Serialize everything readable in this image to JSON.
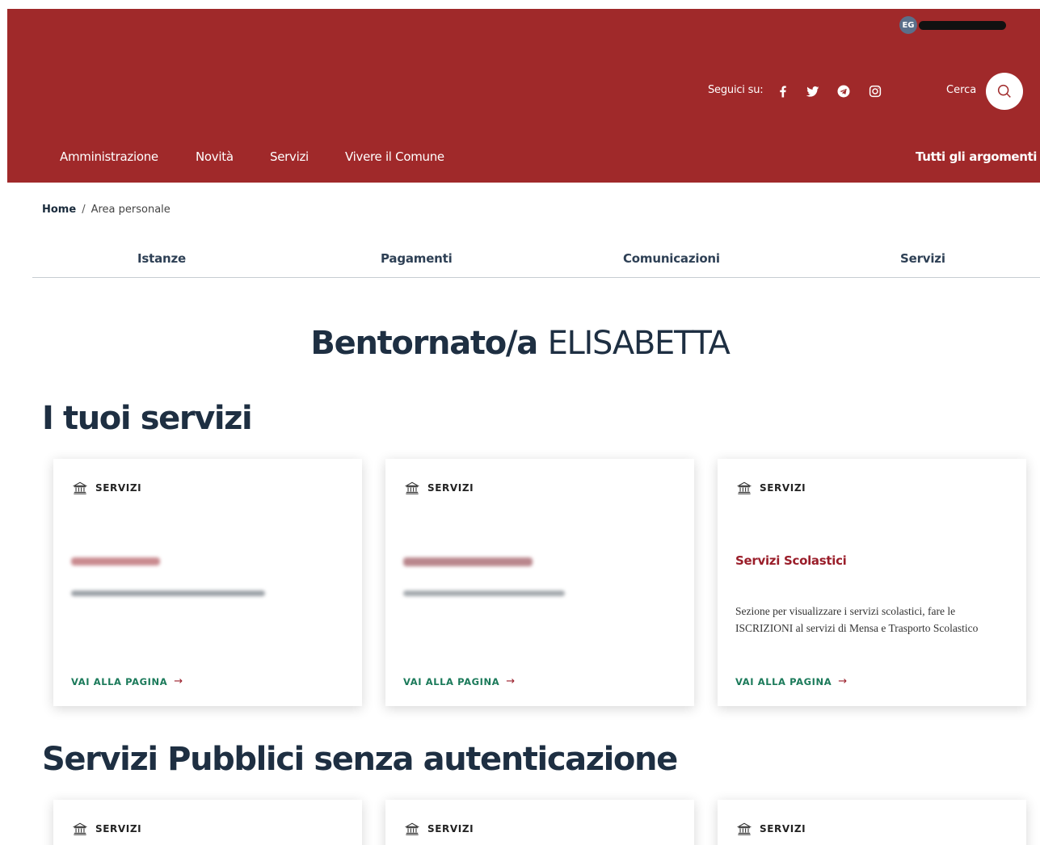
{
  "header": {
    "user_initials": "EG",
    "social_label": "Seguici su:",
    "social_icons": [
      "facebook-icon",
      "twitter-icon",
      "telegram-icon",
      "instagram-icon"
    ],
    "search_label": "Cerca",
    "nav": [
      "Amministrazione",
      "Novità",
      "Servizi",
      "Vivere il Comune"
    ],
    "nav_all_topics": "Tutti gli argomenti"
  },
  "breadcrumb": {
    "home": "Home",
    "separator": "/",
    "current": "Area personale"
  },
  "tabs": [
    "Istanze",
    "Pagamenti",
    "Comunicazioni",
    "Servizi"
  ],
  "welcome": {
    "greeting": "Bentornato/a",
    "name": "ELISABETTA"
  },
  "sections": {
    "your_services": {
      "title": "I tuoi servizi",
      "cards": [
        {
          "category": "SERVIZI",
          "title": "",
          "description": "",
          "link": "VAI ALLA PAGINA"
        },
        {
          "category": "SERVIZI",
          "title": "",
          "description": "",
          "link": "VAI ALLA PAGINA"
        },
        {
          "category": "SERVIZI",
          "title": "Servizi Scolastici",
          "description": "Sezione per visualizzare i servizi scolastici, fare le ISCRIZIONI al servizi di Mensa e Trasporto Scolastico",
          "link": "VAI ALLA PAGINA"
        }
      ]
    },
    "public_services": {
      "title": "Servizi Pubblici senza autenticazione",
      "cards": [
        {
          "category": "SERVIZI"
        },
        {
          "category": "SERVIZI"
        },
        {
          "category": "SERVIZI"
        }
      ]
    }
  },
  "colors": {
    "header_bg": "#a0292a",
    "title_red": "#9a1e2a",
    "link_green": "#1b7a5a",
    "heading": "#1e2f42"
  }
}
